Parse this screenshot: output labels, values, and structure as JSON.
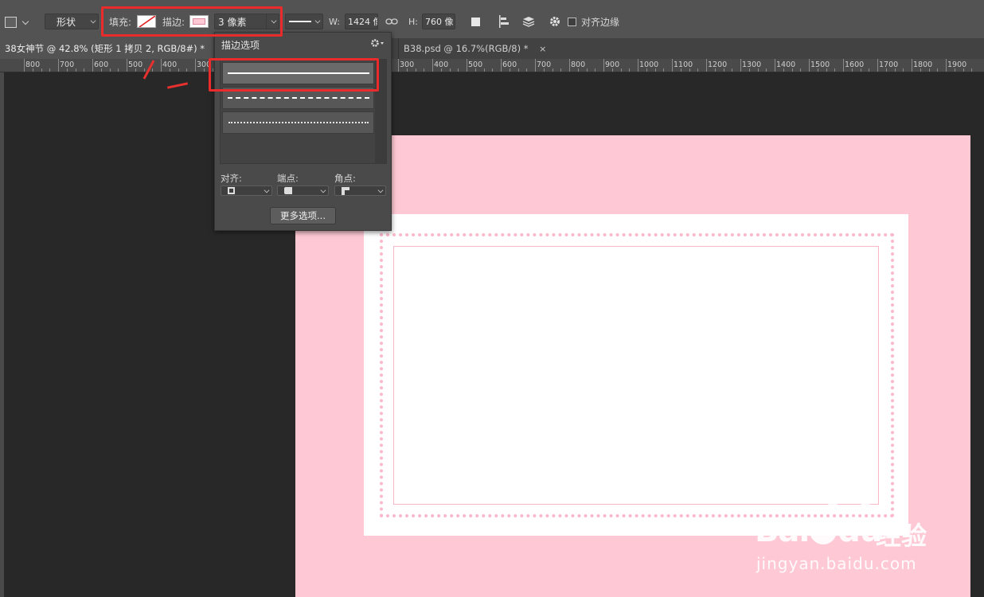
{
  "options_bar": {
    "mode_value": "形状",
    "fill_label": "填充:",
    "stroke_label": "描边:",
    "stroke_width_value": "3 像素",
    "width_label": "W:",
    "width_value": "1424 像",
    "height_label": "H:",
    "height_value": "760 像",
    "align_edges_label": "对齐边缘",
    "stroke_color": "#fec8d4"
  },
  "tabs": [
    {
      "label": "38女神节 @ 42.8% (矩形 1 拷贝 2, RGB/8#) *",
      "close": "×"
    },
    {
      "label": "B38.psd @ 16.7%(RGB/8) *",
      "close": "×"
    }
  ],
  "ruler": {
    "left_labels": [
      "800",
      "700",
      "600",
      "500",
      "400",
      "300"
    ],
    "right_labels": [
      "300",
      "400",
      "500",
      "600",
      "700",
      "800",
      "900",
      "1000",
      "1100",
      "1200",
      "1300",
      "1400",
      "1500",
      "1600",
      "1700",
      "1800",
      "1900"
    ]
  },
  "stroke_panel": {
    "title": "描边选项",
    "line_styles": [
      "solid",
      "dashed",
      "dotted"
    ],
    "align_label": "对齐:",
    "caps_label": "端点:",
    "corners_label": "角点:",
    "more_button": "更多选项..."
  },
  "canvas": {
    "background": "#fec8d4",
    "card_color": "#ffffff",
    "dot_color": "#fdb9cb"
  },
  "watermark": {
    "brand": "Bai",
    "brand_end": "du",
    "suffix": "经验",
    "url": "jingyan.baidu.com"
  }
}
